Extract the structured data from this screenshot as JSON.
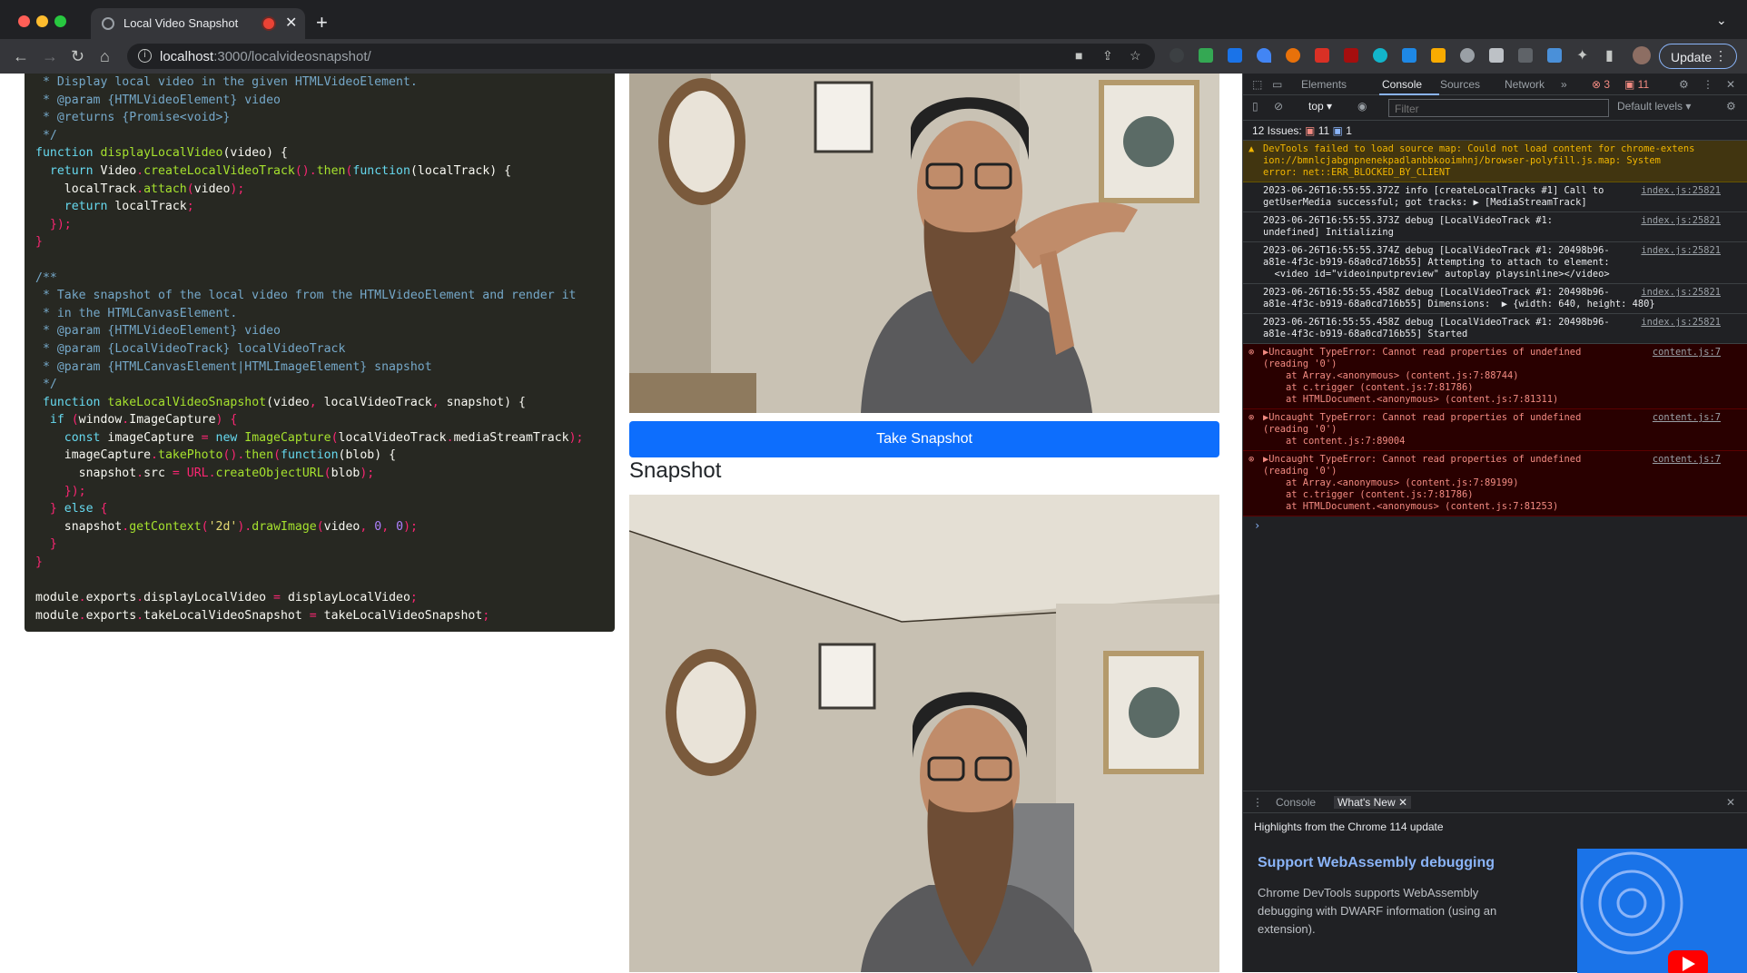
{
  "browser": {
    "tab_title": "Local Video Snapshot",
    "url_host": "localhost",
    "url_path": ":3000/localvideosnapshot/",
    "update_label": "Update"
  },
  "page": {
    "code_lines": [
      [
        [
          "c",
          " * Display local video in the given HTMLVideoElement."
        ]
      ],
      [
        [
          "c",
          " * @param {HTMLVideoElement} video"
        ]
      ],
      [
        [
          "c",
          " * @returns {Promise<void>}"
        ]
      ],
      [
        [
          "c",
          " */"
        ]
      ],
      [
        [
          "k",
          "function "
        ],
        [
          "f",
          "displayLocalVideo"
        ],
        [
          "p",
          "(video) {"
        ]
      ],
      [
        [
          "k",
          "  return "
        ],
        [
          "p",
          "Video"
        ],
        [
          "d",
          "."
        ],
        [
          "f",
          "createLocalVideoTrack"
        ],
        [
          "d",
          "()."
        ],
        [
          "f",
          "then"
        ],
        [
          "d",
          "("
        ],
        [
          "k",
          "function"
        ],
        [
          "p",
          "(localTrack) {"
        ]
      ],
      [
        [
          "p",
          "    localTrack"
        ],
        [
          "d",
          "."
        ],
        [
          "f",
          "attach"
        ],
        [
          "d",
          "("
        ],
        [
          "p",
          "video"
        ],
        [
          "d",
          ");"
        ]
      ],
      [
        [
          "k",
          "    return "
        ],
        [
          "p",
          "localTrack"
        ],
        [
          "d",
          ";"
        ]
      ],
      [
        [
          "d",
          "  });"
        ]
      ],
      [
        [
          "d",
          "}"
        ]
      ],
      [
        [
          "p",
          ""
        ]
      ],
      [
        [
          "c",
          "/**"
        ]
      ],
      [
        [
          "c",
          " * Take snapshot of the local video from the HTMLVideoElement and render it"
        ]
      ],
      [
        [
          "c",
          " * in the HTMLCanvasElement."
        ]
      ],
      [
        [
          "c",
          " * @param {HTMLVideoElement} video"
        ]
      ],
      [
        [
          "c",
          " * @param {LocalVideoTrack} localVideoTrack"
        ]
      ],
      [
        [
          "c",
          " * @param {HTMLCanvasElement|HTMLImageElement} snapshot"
        ]
      ],
      [
        [
          "c",
          " */"
        ]
      ],
      [
        [
          "k",
          " function "
        ],
        [
          "f",
          "takeLocalVideoSnapshot"
        ],
        [
          "p",
          "(video"
        ],
        [
          "d",
          ", "
        ],
        [
          "p",
          "localVideoTrack"
        ],
        [
          "d",
          ", "
        ],
        [
          "p",
          "snapshot) {"
        ]
      ],
      [
        [
          "k",
          "  if "
        ],
        [
          "d",
          "("
        ],
        [
          "p",
          "window"
        ],
        [
          "d",
          "."
        ],
        [
          "p",
          "ImageCapture"
        ],
        [
          "d",
          ") {"
        ]
      ],
      [
        [
          "k",
          "    const "
        ],
        [
          "p",
          "imageCapture "
        ],
        [
          "r",
          "= "
        ],
        [
          "k",
          "new "
        ],
        [
          "f",
          "ImageCapture"
        ],
        [
          "d",
          "("
        ],
        [
          "p",
          "localVideoTrack"
        ],
        [
          "d",
          "."
        ],
        [
          "p",
          "mediaStreamTrack"
        ],
        [
          "d",
          ");"
        ]
      ],
      [
        [
          "p",
          "    imageCapture"
        ],
        [
          "d",
          "."
        ],
        [
          "f",
          "takePhoto"
        ],
        [
          "d",
          "()."
        ],
        [
          "f",
          "then"
        ],
        [
          "d",
          "("
        ],
        [
          "k",
          "function"
        ],
        [
          "p",
          "(blob) {"
        ]
      ],
      [
        [
          "p",
          "      snapshot"
        ],
        [
          "d",
          "."
        ],
        [
          "p",
          "src "
        ],
        [
          "r",
          "= "
        ],
        [
          "r",
          "URL"
        ],
        [
          "d",
          "."
        ],
        [
          "f",
          "createObjectURL"
        ],
        [
          "d",
          "("
        ],
        [
          "p",
          "blob"
        ],
        [
          "d",
          ");"
        ]
      ],
      [
        [
          "d",
          "    });"
        ]
      ],
      [
        [
          "d",
          "  } "
        ],
        [
          "k",
          "else "
        ],
        [
          "d",
          "{"
        ]
      ],
      [
        [
          "p",
          "    snapshot"
        ],
        [
          "d",
          "."
        ],
        [
          "f",
          "getContext"
        ],
        [
          "d",
          "("
        ],
        [
          "s",
          "'2d'"
        ],
        [
          "d",
          ")."
        ],
        [
          "f",
          "drawImage"
        ],
        [
          "d",
          "("
        ],
        [
          "p",
          "video"
        ],
        [
          "d",
          ", "
        ],
        [
          "n",
          "0"
        ],
        [
          "d",
          ", "
        ],
        [
          "n",
          "0"
        ],
        [
          "d",
          ");"
        ]
      ],
      [
        [
          "d",
          "  }"
        ]
      ],
      [
        [
          "d",
          "}"
        ]
      ],
      [
        [
          "p",
          ""
        ]
      ],
      [
        [
          "p",
          "module"
        ],
        [
          "d",
          "."
        ],
        [
          "p",
          "exports"
        ],
        [
          "d",
          "."
        ],
        [
          "p",
          "displayLocalVideo "
        ],
        [
          "r",
          "= "
        ],
        [
          "p",
          "displayLocalVideo"
        ],
        [
          "d",
          ";"
        ]
      ],
      [
        [
          "p",
          "module"
        ],
        [
          "d",
          "."
        ],
        [
          "p",
          "exports"
        ],
        [
          "d",
          "."
        ],
        [
          "p",
          "takeLocalVideoSnapshot "
        ],
        [
          "r",
          "= "
        ],
        [
          "p",
          "takeLocalVideoSnapshot"
        ],
        [
          "d",
          ";"
        ]
      ]
    ],
    "snapshot_button": "Take Snapshot",
    "snapshot_heading": "Snapshot"
  },
  "devtools": {
    "tabs": [
      "Elements",
      "Console",
      "Sources",
      "Network"
    ],
    "error_count": "3",
    "warning_count": "11",
    "context": "top",
    "filter_placeholder": "Filter",
    "levels": "Default levels",
    "issues_label": "12 Issues:",
    "issues_err": "11",
    "issues_info": "1",
    "messages": [
      {
        "type": "warn",
        "text": "DevTools failed to load source map: Could not load content for chrome-extens\nion://bmnlcjabgnpnenekpadlanbbkooimhnj/browser-polyfill.js.map: System\nerror: net::ERR_BLOCKED_BY_CLIENT",
        "src": ""
      },
      {
        "type": "log",
        "text": "2023-06-26T16:55:55.372Z info [createLocalTracks #1] Call to\ngetUserMedia successful; got tracks: ▶ [MediaStreamTrack]",
        "src": "index.js:25821"
      },
      {
        "type": "log",
        "text": "2023-06-26T16:55:55.373Z debug [LocalVideoTrack #1:\nundefined] Initializing",
        "src": "index.js:25821"
      },
      {
        "type": "log",
        "text": "2023-06-26T16:55:55.374Z debug [LocalVideoTrack #1: 20498b96-\na81e-4f3c-b919-68a0cd716b55] Attempting to attach to element:\n  <video id=\"videoinputpreview\" autoplay playsinline></video>",
        "src": "index.js:25821"
      },
      {
        "type": "log",
        "text": "2023-06-26T16:55:55.458Z debug [LocalVideoTrack #1: 20498b96-\na81e-4f3c-b919-68a0cd716b55] Dimensions:  ▶ {width: 640, height: 480}",
        "src": "index.js:25821"
      },
      {
        "type": "log",
        "text": "2023-06-26T16:55:55.458Z debug [LocalVideoTrack #1: 20498b96-\na81e-4f3c-b919-68a0cd716b55] Started",
        "src": "index.js:25821"
      },
      {
        "type": "err",
        "text": "▶Uncaught TypeError: Cannot read properties of undefined\n(reading '0')\n    at Array.<anonymous> (content.js:7:88744)\n    at c.trigger (content.js:7:81786)\n    at HTMLDocument.<anonymous> (content.js:7:81311)",
        "src": "content.js:7"
      },
      {
        "type": "err",
        "text": "▶Uncaught TypeError: Cannot read properties of undefined\n(reading '0')\n    at content.js:7:89004",
        "src": "content.js:7"
      },
      {
        "type": "err",
        "text": "▶Uncaught TypeError: Cannot read properties of undefined\n(reading '0')\n    at Array.<anonymous> (content.js:7:89199)\n    at c.trigger (content.js:7:81786)\n    at HTMLDocument.<anonymous> (content.js:7:81253)",
        "src": "content.js:7"
      }
    ],
    "drawer_tabs": [
      "Console",
      "What's New"
    ],
    "highlights": "Highlights from the Chrome 114 update",
    "whatsnew_title": "Support WebAssembly debugging",
    "whatsnew_text": "Chrome DevTools supports WebAssembly debugging with DWARF information (using an extension)."
  }
}
